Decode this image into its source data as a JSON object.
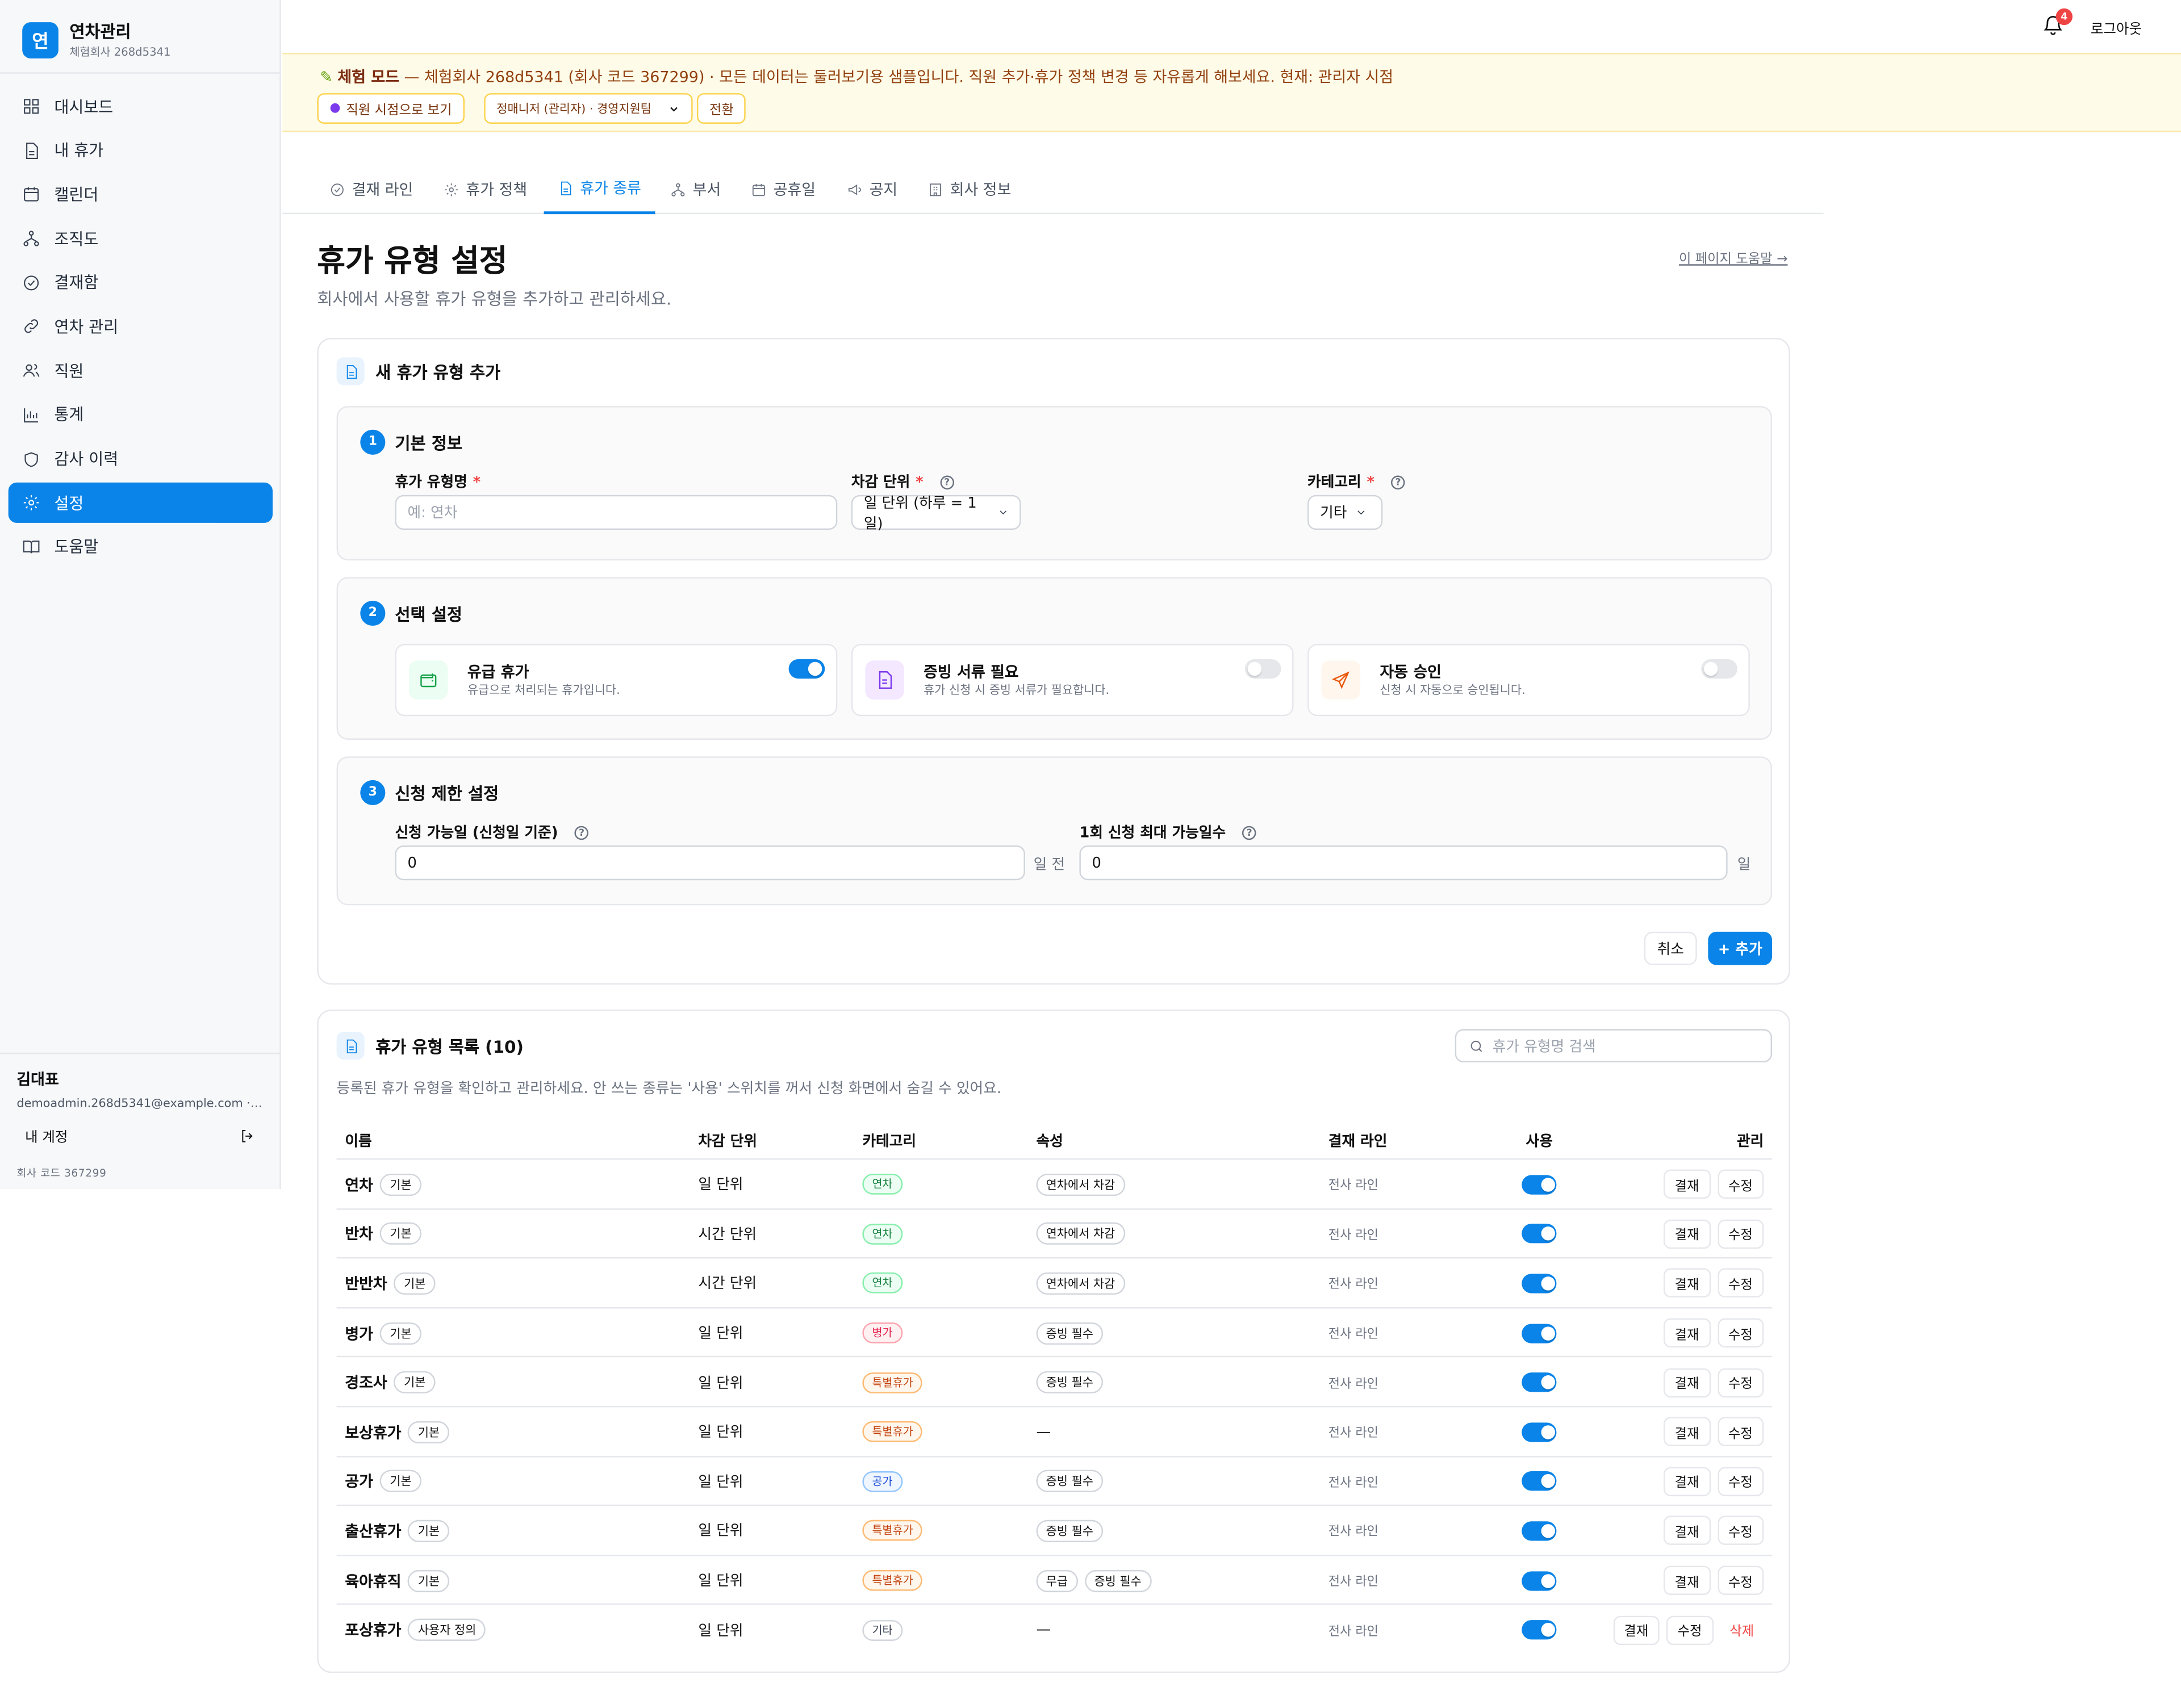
{
  "brand": {
    "logo_char": "연",
    "name": "연차관리",
    "sub": "체험회사 268d5341"
  },
  "sidebar": {
    "items": [
      {
        "label": "대시보드",
        "icon": "dashboard-icon"
      },
      {
        "label": "내 휴가",
        "icon": "document-icon"
      },
      {
        "label": "캘린더",
        "icon": "calendar-icon"
      },
      {
        "label": "조직도",
        "icon": "org-chart-icon"
      },
      {
        "label": "결재함",
        "icon": "check-circle-icon"
      },
      {
        "label": "연차 관리",
        "icon": "link-icon"
      },
      {
        "label": "직원",
        "icon": "users-icon"
      },
      {
        "label": "통계",
        "icon": "bar-chart-icon"
      },
      {
        "label": "감사 이력",
        "icon": "shield-icon"
      },
      {
        "label": "설정",
        "icon": "gear-icon",
        "active": true
      },
      {
        "label": "도움말",
        "icon": "book-icon"
      }
    ],
    "user": {
      "name": "김대표",
      "email": "demoadmin.268d5341@example.com · 경영지원팀",
      "account_label": "내 계정",
      "company_code": "회사 코드 367299"
    }
  },
  "topbar": {
    "notification_count": "4",
    "logout_label": "로그아웃"
  },
  "banner": {
    "mode_label": "체험 모드",
    "text": " — 체험회사 268d5341 (회사 코드 367299) · 모든 데이터는 둘러보기용 샘플입니다. 직원 추가·휴가 정책 변경 등 자유롭게 해보세요. 현재: 관리자 시점",
    "view_button": "직원 시점으로 보기",
    "select_value": "정매니저 (관리자) · 경영지원팀",
    "switch_button": "전환"
  },
  "tabs": [
    {
      "label": "결재 라인",
      "icon": "check-circle-icon"
    },
    {
      "label": "휴가 정책",
      "icon": "gear-icon"
    },
    {
      "label": "휴가 종류",
      "icon": "document-icon",
      "active": true
    },
    {
      "label": "부서",
      "icon": "org-chart-icon"
    },
    {
      "label": "공휴일",
      "icon": "calendar-icon"
    },
    {
      "label": "공지",
      "icon": "megaphone-icon"
    },
    {
      "label": "회사 정보",
      "icon": "building-icon"
    }
  ],
  "page": {
    "title": "휴가 유형 설정",
    "description": "회사에서 사용할 휴가 유형을 추가하고 관리하세요.",
    "help_link": "이 페이지 도움말 →"
  },
  "form": {
    "title": "새 휴가 유형 추가",
    "section1": {
      "step": "1",
      "title": "기본 정보",
      "name_label": "휴가 유형명",
      "name_placeholder": "예: 연차",
      "unit_label": "차감 단위",
      "unit_value": "일 단위 (하루 = 1일)",
      "category_label": "카테고리",
      "category_value": "기타"
    },
    "section2": {
      "step": "2",
      "title": "선택 설정",
      "options": [
        {
          "title": "유급 휴가",
          "desc": "유급으로 처리되는 휴가입니다.",
          "icon": "wallet-icon",
          "on": true
        },
        {
          "title": "증빙 서류 필요",
          "desc": "휴가 신청 시 증빙 서류가 필요합니다.",
          "icon": "file-icon",
          "on": false
        },
        {
          "title": "자동 승인",
          "desc": "신청 시 자동으로 승인됩니다.",
          "icon": "send-icon",
          "on": false
        }
      ]
    },
    "section3": {
      "step": "3",
      "title": "신청 제한 설정",
      "advance_label": "신청 가능일 (신청일 기준)",
      "advance_value": "0",
      "advance_unit": "일 전",
      "max_label": "1회 신청 최대 가능일수",
      "max_value": "0",
      "max_unit": "일"
    },
    "cancel_label": "취소",
    "add_label": "+ 추가"
  },
  "list": {
    "title": "휴가 유형 목록 (10)",
    "search_placeholder": "휴가 유형명 검색",
    "description": "등록된 휴가 유형을 확인하고 관리하세요. 안 쓰는 종류는 '사용' 스위치를 꺼서 신청 화면에서 숨길 수 있어요.",
    "columns": [
      "이름",
      "차감 단위",
      "카테고리",
      "속성",
      "결재 라인",
      "사용",
      "관리"
    ],
    "action_approval": "결재",
    "action_edit": "수정",
    "action_delete": "삭제",
    "rows": [
      {
        "name": "연차",
        "tag": "기본",
        "unit": "일 단위",
        "category": "연차",
        "attrs": [
          "연차에서 차감"
        ],
        "approval": "전사 라인",
        "enabled": true,
        "deletable": false
      },
      {
        "name": "반차",
        "tag": "기본",
        "unit": "시간 단위",
        "category": "연차",
        "attrs": [
          "연차에서 차감"
        ],
        "approval": "전사 라인",
        "enabled": true,
        "deletable": false
      },
      {
        "name": "반반차",
        "tag": "기본",
        "unit": "시간 단위",
        "category": "연차",
        "attrs": [
          "연차에서 차감"
        ],
        "approval": "전사 라인",
        "enabled": true,
        "deletable": false
      },
      {
        "name": "병가",
        "tag": "기본",
        "unit": "일 단위",
        "category": "병가",
        "attrs": [
          "증빙 필수"
        ],
        "approval": "전사 라인",
        "enabled": true,
        "deletable": false
      },
      {
        "name": "경조사",
        "tag": "기본",
        "unit": "일 단위",
        "category": "특별휴가",
        "attrs": [
          "증빙 필수"
        ],
        "approval": "전사 라인",
        "enabled": true,
        "deletable": false
      },
      {
        "name": "보상휴가",
        "tag": "기본",
        "unit": "일 단위",
        "category": "특별휴가",
        "attrs": [],
        "approval": "전사 라인",
        "enabled": true,
        "deletable": false
      },
      {
        "name": "공가",
        "tag": "기본",
        "unit": "일 단위",
        "category": "공가",
        "attrs": [
          "증빙 필수"
        ],
        "approval": "전사 라인",
        "enabled": true,
        "deletable": false
      },
      {
        "name": "출산휴가",
        "tag": "기본",
        "unit": "일 단위",
        "category": "특별휴가",
        "attrs": [
          "증빙 필수"
        ],
        "approval": "전사 라인",
        "enabled": true,
        "deletable": false
      },
      {
        "name": "육아휴직",
        "tag": "기본",
        "unit": "일 단위",
        "category": "특별휴가",
        "attrs": [
          "무급",
          "증빙 필수"
        ],
        "approval": "전사 라인",
        "enabled": true,
        "deletable": false
      },
      {
        "name": "포상휴가",
        "tag": "사용자 정의",
        "unit": "일 단위",
        "category": "기타",
        "attrs": [],
        "approval": "전사 라인",
        "enabled": true,
        "deletable": true
      }
    ],
    "empty_attr": "—"
  }
}
